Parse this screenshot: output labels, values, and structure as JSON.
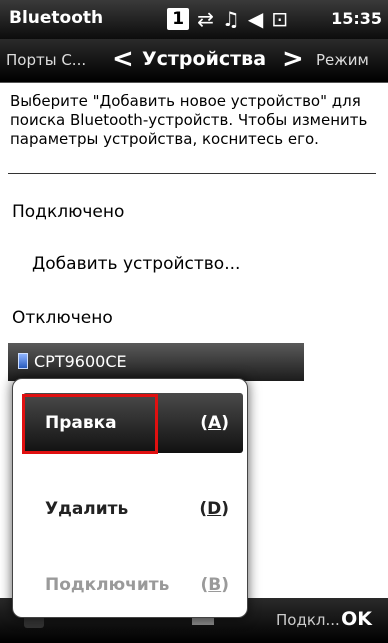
{
  "status_bar": {
    "app_title": "Bluetooth",
    "sim_indicator": "1",
    "icons": [
      "sim-icon",
      "data-sync-icon",
      "signal-icon",
      "volume-icon",
      "battery-icon"
    ],
    "time": "15:35"
  },
  "tabs": {
    "previous_label": "Порты С...",
    "current_label": "Устройства",
    "next_label": "Режим"
  },
  "content": {
    "instructions": "Выберите \"Добавить новое устройство\" для поиска Bluetooth-устройств. Чтобы изменить параметры устройства, коснитесь его.",
    "connected_header": "Подключено",
    "add_device_label": "Добавить устройство...",
    "disconnected_header": "Отключено",
    "device_name": "CPT9600CE"
  },
  "context_menu": {
    "items": [
      {
        "label": "Правка",
        "key": "A"
      },
      {
        "label": "Удалить",
        "key": "D"
      },
      {
        "label": "Подключить",
        "key": "B"
      }
    ]
  },
  "bottom_bar": {
    "right_softkey_label": "OK",
    "left_softkey_label": "Подкл..."
  },
  "colors": {
    "highlight": "#e01010",
    "selection_dark": "#1c1c1c",
    "disabled_text": "#9a9a9a"
  }
}
